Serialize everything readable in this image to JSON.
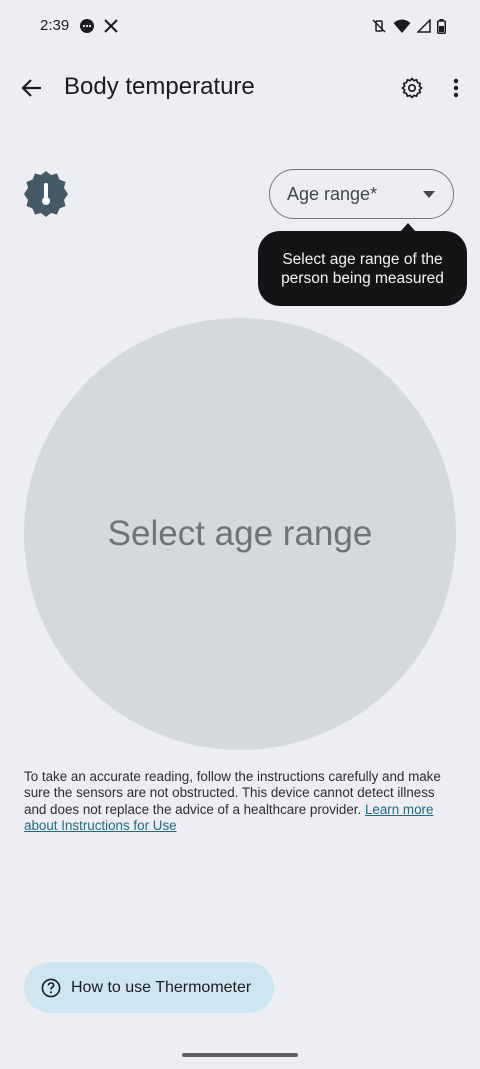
{
  "status_bar": {
    "time": "2:39"
  },
  "app_bar": {
    "title": "Body temperature"
  },
  "age_dropdown": {
    "label": "Age range*"
  },
  "tooltip": {
    "text": "Select age range of the person being measured"
  },
  "measure": {
    "prompt": "Select age range"
  },
  "disclaimer": {
    "text": "To take an accurate reading, follow the instructions carefully and make sure the sensors are not obstructed. This device cannot detect illness and does not replace the advice of a healthcare provider. ",
    "link": "Learn more about Instructions for Use"
  },
  "howto_button": {
    "label": "How to use Thermometer"
  },
  "colors": {
    "background": "#eceef3",
    "circle": "#d5d9dc",
    "tooltip": "#121416",
    "button": "#cfe6f1",
    "badge": "#455a64",
    "link": "#1d6b86"
  }
}
